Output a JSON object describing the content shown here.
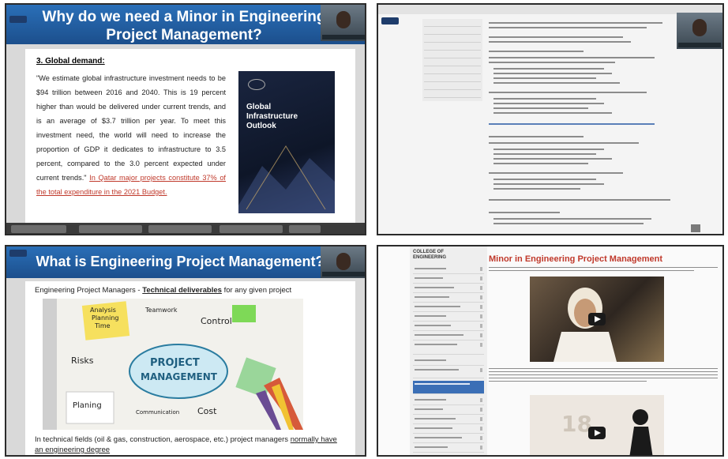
{
  "panel1": {
    "title": "Why do we need a Minor in Engineering Project Management?",
    "heading": "3. Global demand:",
    "paragraph": "\"We estimate global infrastructure investment needs to be $94 trillion between 2016 and 2040. This is 19 percent higher than would be delivered under current trends, and is an average of $3.7 trillion per year. To meet this investment need, the world will need to increase the proportion of GDP it dedicates to infrastructure to 3.5 percent, compared to the 3.0 percent expected under current trends.\"",
    "link_text": "In Qatar major projects constitute 37% of the total expenditure in the 2021 Budget.",
    "book_title": "Global Infrastructure Outlook"
  },
  "panel2": {},
  "panel3": {
    "title": "What is Engineering Project Management?",
    "caption_prefix": "Engineering Project Managers -",
    "caption_bold": "Technical deliverables",
    "caption_suffix": "for any given project",
    "image_words": {
      "project": "PROJECT",
      "management": "MANAGEMENT",
      "analysis": "Analysis",
      "planning": "Planning",
      "time": "Time",
      "teamwork": "Teamwork",
      "control": "Control",
      "risks": "Risks",
      "planing": "Planing",
      "communication": "Communication",
      "cost": "Cost"
    },
    "note_prefix": "In technical fields (oil & gas, construction, aerospace, etc.) project managers",
    "note_underlined": "normally have an engineering degree"
  },
  "panel4": {
    "sidebar_header": "COLLEGE OF ENGINEERING",
    "page_title": "Minor in Engineering Project Management",
    "video2_text": "18"
  },
  "colors": {
    "title_blue": "#1c4f8c",
    "link_red": "#c0392b",
    "nav_selected": "#3b6fb6"
  }
}
